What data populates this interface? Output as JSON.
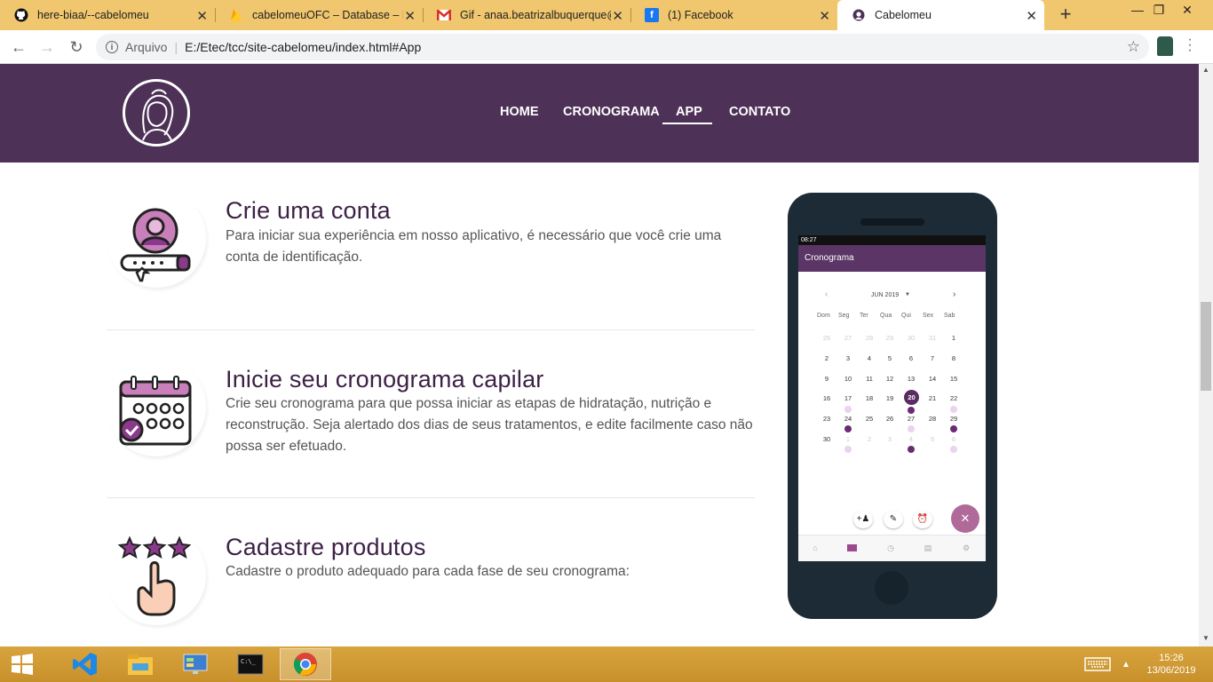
{
  "browser": {
    "tabs": [
      {
        "title": "here-biaa/--cabelomeu",
        "icon": "github-icon",
        "active": false
      },
      {
        "title": "cabelomeuOFC – Database – Fir",
        "icon": "firebase-icon",
        "active": false
      },
      {
        "title": "Gif - anaa.beatrizalbuquerque@",
        "icon": "gmail-icon",
        "active": false
      },
      {
        "title": "(1) Facebook",
        "icon": "facebook-icon",
        "active": false
      },
      {
        "title": "Cabelomeu",
        "icon": "cabelomeu-icon",
        "active": true
      }
    ],
    "address": {
      "security_label": "Arquivo",
      "url": "E:/Etec/tcc/site-cabelomeu/index.html#App"
    }
  },
  "site": {
    "nav": {
      "home": "HOME",
      "cronograma": "CRONOGRAMA",
      "app": "APP",
      "contato": "CONTATO",
      "active": "APP"
    },
    "features": [
      {
        "title": "Crie uma conta",
        "description": "Para iniciar sua experiência em nosso aplicativo, é necessário que você crie uma conta de identificação.",
        "icon": "user-account-icon"
      },
      {
        "title": "Inicie seu cronograma capilar",
        "description": "Crie seu cronograma para que possa iniciar as etapas de hidratação, nutrição e reconstrução. Seja alertado dos dias de seus tratamentos, e edite facilmente caso não possa ser efetuado.",
        "icon": "calendar-icon"
      },
      {
        "title": "Cadastre produtos",
        "description": "Cadastre o produto adequado para cada fase de seu cronograma:",
        "icon": "stars-hand-icon"
      }
    ]
  },
  "phone_app": {
    "status_time": "08:27",
    "appbar_title": "Cronograma",
    "month": "JUN 2019",
    "weekdays": [
      "Dom",
      "Seg",
      "Ter",
      "Qua",
      "Qui",
      "Sex",
      "Sab"
    ],
    "weeks": [
      [
        "26",
        "27",
        "28",
        "29",
        "30",
        "31",
        "1"
      ],
      [
        "2",
        "3",
        "4",
        "5",
        "6",
        "7",
        "8"
      ],
      [
        "9",
        "10",
        "11",
        "12",
        "13",
        "14",
        "15"
      ],
      [
        "16",
        "17",
        "18",
        "19",
        "20",
        "21",
        "22"
      ],
      [
        "23",
        "24",
        "25",
        "26",
        "27",
        "28",
        "29"
      ],
      [
        "30",
        "1",
        "2",
        "3",
        "4",
        "5",
        "6"
      ]
    ],
    "today": "20"
  },
  "taskbar": {
    "time": "15:26",
    "date": "13/06/2019"
  }
}
